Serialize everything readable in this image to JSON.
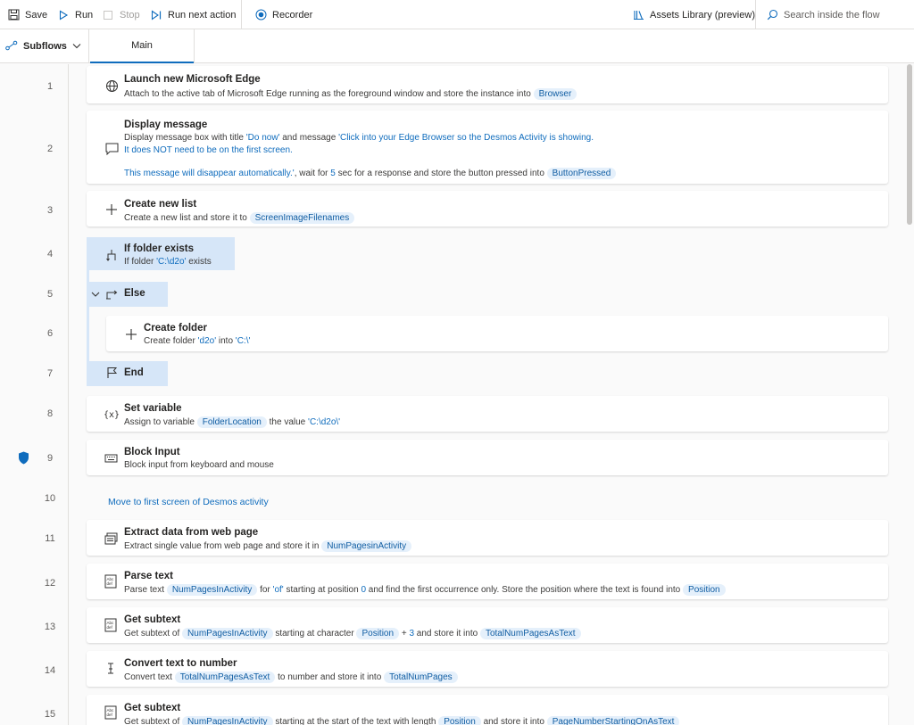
{
  "toolbar": {
    "save": "Save",
    "run": "Run",
    "stop": "Stop",
    "run_next": "Run next action",
    "recorder": "Recorder",
    "assets": "Assets Library (preview)",
    "search_placeholder": "Search inside the flow"
  },
  "tabs": {
    "subflows": "Subflows",
    "main": "Main"
  },
  "lines": [
    "1",
    "2",
    "3",
    "4",
    "5",
    "6",
    "7",
    "8",
    "9",
    "10",
    "11",
    "12",
    "13",
    "14",
    "15"
  ],
  "actions": {
    "a1": {
      "title": "Launch new Microsoft Edge",
      "d1": "Attach to the active tab of Microsoft Edge running as the foreground window and store the instance into",
      "var": "Browser"
    },
    "a2": {
      "title": "Display message",
      "d1": "Display message box with title",
      "title_val": "'Do now'",
      "d2": "and message",
      "msg1": "'Click into your Edge Browser so the Desmos Activity is showing.",
      "msg2": "It does NOT need to be on the first screen.",
      "msg3": "This message will disappear automatically.'",
      "d3": ", wait for",
      "secs": "5",
      "d4": "sec for a response and store the button pressed into",
      "var": "ButtonPressed"
    },
    "a3": {
      "title": "Create new list",
      "d1": "Create a new list and store it to",
      "var": "ScreenImageFilenames"
    },
    "a4": {
      "title": "If folder exists",
      "d1": "If folder",
      "path": "'C:\\d2o'",
      "d2": "exists"
    },
    "a5": {
      "title": "Else"
    },
    "a6": {
      "title": "Create folder",
      "d1": "Create folder",
      "name": "'d2o'",
      "d2": "into",
      "path": "'C:\\'"
    },
    "a7": {
      "title": "End"
    },
    "a8": {
      "title": "Set variable",
      "d1": "Assign to variable",
      "var": "FolderLocation",
      "d2": "the value",
      "val": "'C:\\d2o\\'"
    },
    "a9": {
      "title": "Block Input",
      "d1": "Block input from keyboard and mouse"
    },
    "c10": "Move to first screen of Desmos activity",
    "a11": {
      "title": "Extract data from web page",
      "d1": "Extract single value from web page and store it in",
      "var": "NumPagesinActivity"
    },
    "a12": {
      "title": "Parse text",
      "d1": "Parse text",
      "var": "NumPagesInActivity",
      "d2": "for",
      "of": "'of'",
      "d3": "starting at position",
      "pos": "0",
      "d4": "and find the first occurrence only. Store the position where the text is found into",
      "var2": "Position"
    },
    "a13": {
      "title": "Get subtext",
      "d1": "Get subtext of",
      "var": "NumPagesInActivity",
      "d2": "starting at character",
      "var2": "Position",
      "d3": "+",
      "num": "3",
      "d4": "and store it into",
      "var3": "TotalNumPagesAsText"
    },
    "a14": {
      "title": "Convert text to number",
      "d1": "Convert text",
      "var": "TotalNumPagesAsText",
      "d2": "to number and store it into",
      "var2": "TotalNumPages"
    },
    "a15": {
      "title": "Get subtext",
      "d1": "Get subtext of",
      "var": "NumPagesInActivity",
      "d2": "starting at the start of the text with length",
      "var2": "Position",
      "d3": "and store it into",
      "var3": "PageNumberStartingOnAsText"
    }
  },
  "colors": {
    "accent": "#0f6cbd",
    "pill_bg": "#e5f0fb",
    "selected_bg": "#d6e6f8"
  }
}
